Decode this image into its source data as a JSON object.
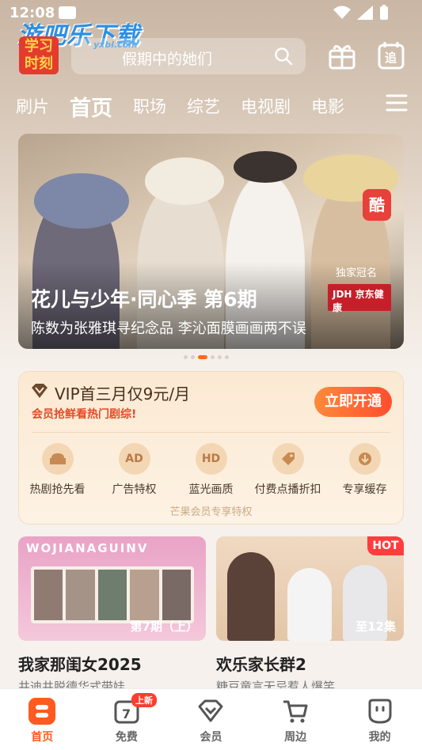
{
  "status": {
    "time": "12:08"
  },
  "watermark": {
    "text": "游吧乐下载",
    "sub": "yxbl.com"
  },
  "logo": {
    "line1": "学习",
    "line2": "时刻"
  },
  "search": {
    "placeholder": "假期中的她们"
  },
  "header_icons": {
    "gift": "gift-icon",
    "follow_label": "追"
  },
  "tabs": [
    {
      "label": "刷片"
    },
    {
      "label": "首页"
    },
    {
      "label": "职场"
    },
    {
      "label": "综艺"
    },
    {
      "label": "电视剧"
    },
    {
      "label": "电影"
    }
  ],
  "banner": {
    "title": "花儿与少年·同心季 第6期",
    "subtitle": "陈数为张雅琪寻纪念品 李沁面膜画画两不误",
    "exclusive": "独家冠名",
    "sponsor": "JDH 京东健康",
    "badge": "酷",
    "dots_total": 6,
    "dots_active": 2
  },
  "vip": {
    "headline": "VIP首三月仅9元/月",
    "hint": "会员抢鲜看热门剧综!",
    "button": "立即开通",
    "perks": [
      {
        "label": "热剧抢先看",
        "icon": "sofa-icon"
      },
      {
        "label": "广告特权",
        "icon": "ad-icon",
        "glyph": "AD"
      },
      {
        "label": "蓝光画质",
        "icon": "hd-icon",
        "glyph": "HD"
      },
      {
        "label": "付费点播折扣",
        "icon": "tag-icon"
      },
      {
        "label": "专享缓存",
        "icon": "download-icon"
      }
    ],
    "footer": "芒果会员专享特权"
  },
  "cards": [
    {
      "title": "我家那闺女2025",
      "desc": "井迪井脱德华式带娃",
      "episode": "第7期（上）",
      "banner_text": "WOJIANAGUINV"
    },
    {
      "title": "欢乐家长群2",
      "desc": "糖豆童言无忌惹人爆笑",
      "episode": "至12集",
      "badge": "HOT"
    }
  ],
  "nav": [
    {
      "label": "首页",
      "icon": "home-icon",
      "active": true
    },
    {
      "label": "免费",
      "icon": "calendar-icon",
      "badge": "上新"
    },
    {
      "label": "会员",
      "icon": "diamond-icon"
    },
    {
      "label": "周边",
      "icon": "cart-icon"
    },
    {
      "label": "我的",
      "icon": "profile-icon"
    }
  ],
  "colors": {
    "accent": "#ff5a1f",
    "vip_button": "#ff4d2e",
    "hot": "#ff3d3d"
  }
}
